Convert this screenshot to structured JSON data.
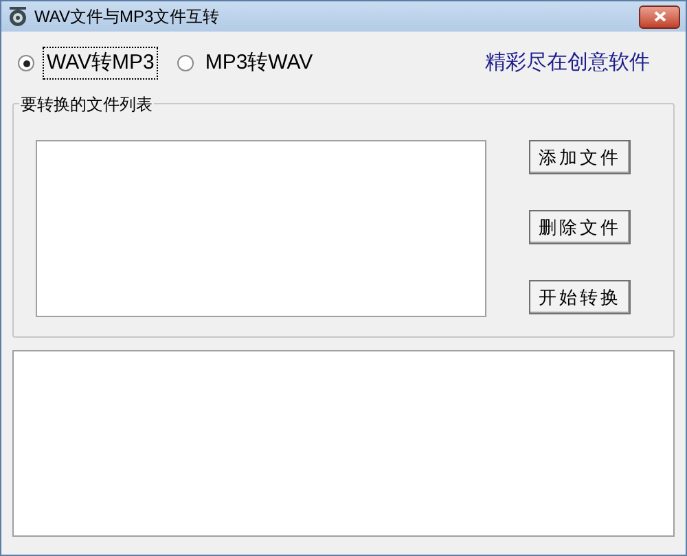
{
  "window": {
    "title": "WAV文件与MP3文件互转"
  },
  "modes": [
    {
      "label": "WAV转MP3",
      "selected": true
    },
    {
      "label": "MP3转WAV",
      "selected": false
    }
  ],
  "slogan": "精彩尽在创意软件",
  "file_group": {
    "title": "要转换的文件列表",
    "buttons": [
      "添加文件",
      "删除文件",
      "开始转换"
    ]
  }
}
